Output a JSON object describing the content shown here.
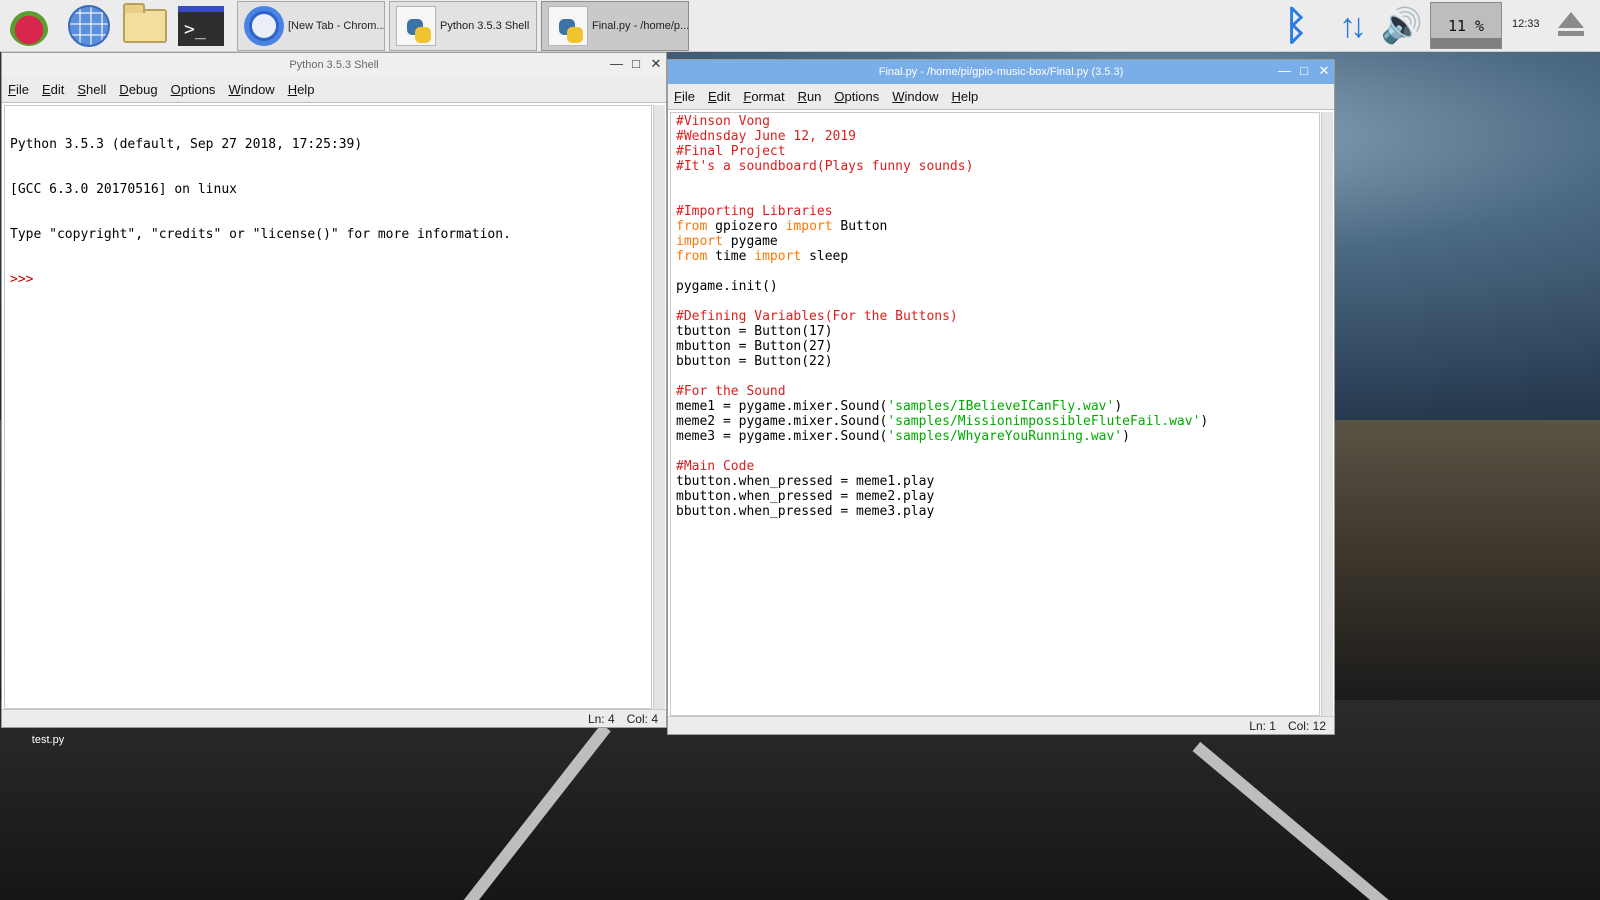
{
  "taskbar": {
    "launchers": [
      "raspberry-menu-icon",
      "web-browser-icon",
      "file-manager-icon",
      "terminal-icon"
    ],
    "terminal_glyph": ">_",
    "tasks": [
      {
        "label": "[New Tab - Chrom...",
        "icon": "chromium-icon"
      },
      {
        "label": "Python 3.5.3 Shell",
        "icon": "python-icon"
      },
      {
        "label": "Final.py - /home/p...",
        "icon": "python-icon"
      }
    ],
    "cpu_label": "11 %",
    "clock": "12:33"
  },
  "shell": {
    "title": "Python 3.5.3 Shell",
    "menus": [
      "File",
      "Edit",
      "Shell",
      "Debug",
      "Options",
      "Window",
      "Help"
    ],
    "lines": [
      "Python 3.5.3 (default, Sep 27 2018, 17:25:39)",
      "[GCC 6.3.0 20170516] on linux",
      "Type \"copyright\", \"credits\" or \"license()\" for more information."
    ],
    "prompt": ">>>",
    "status": {
      "ln": "Ln: 4",
      "col": "Col: 4"
    }
  },
  "editor": {
    "title": "Final.py - /home/pi/gpio-music-box/Final.py (3.5.3)",
    "menus": [
      "File",
      "Edit",
      "Format",
      "Run",
      "Options",
      "Window",
      "Help"
    ],
    "code": [
      [
        {
          "t": "#Vinson Vong",
          "c": "comment"
        }
      ],
      [
        {
          "t": "#Wednsday June 12, 2019",
          "c": "comment"
        }
      ],
      [
        {
          "t": "#Final Project",
          "c": "comment"
        }
      ],
      [
        {
          "t": "#It's a soundboard(Plays funny sounds)",
          "c": "comment"
        }
      ],
      [],
      [],
      [
        {
          "t": "#Importing Libraries",
          "c": "comment"
        }
      ],
      [
        {
          "t": "from",
          "c": "kw"
        },
        {
          "t": " gpiozero ",
          "c": ""
        },
        {
          "t": "import",
          "c": "kw"
        },
        {
          "t": " Button",
          "c": ""
        }
      ],
      [
        {
          "t": "import",
          "c": "kw"
        },
        {
          "t": " pygame",
          "c": ""
        }
      ],
      [
        {
          "t": "from",
          "c": "kw"
        },
        {
          "t": " time ",
          "c": ""
        },
        {
          "t": "import",
          "c": "kw"
        },
        {
          "t": " sleep",
          "c": ""
        }
      ],
      [],
      [
        {
          "t": "pygame.init()",
          "c": ""
        }
      ],
      [],
      [
        {
          "t": "#Defining Variables(For the Buttons)",
          "c": "comment"
        }
      ],
      [
        {
          "t": "tbutton = Button(17)",
          "c": ""
        }
      ],
      [
        {
          "t": "mbutton = Button(27)",
          "c": ""
        }
      ],
      [
        {
          "t": "bbutton = Button(22)",
          "c": ""
        }
      ],
      [],
      [
        {
          "t": "#For the Sound",
          "c": "comment"
        }
      ],
      [
        {
          "t": "meme1 = pygame.mixer.Sound(",
          "c": ""
        },
        {
          "t": "'samples/IBelieveICanFly.wav'",
          "c": "str"
        },
        {
          "t": ")",
          "c": ""
        }
      ],
      [
        {
          "t": "meme2 = pygame.mixer.Sound(",
          "c": ""
        },
        {
          "t": "'samples/MissionimpossibleFluteFail.wav'",
          "c": "str"
        },
        {
          "t": ")",
          "c": ""
        }
      ],
      [
        {
          "t": "meme3 = pygame.mixer.Sound(",
          "c": ""
        },
        {
          "t": "'samples/WhyareYouRunning.wav'",
          "c": "str"
        },
        {
          "t": ")",
          "c": ""
        }
      ],
      [],
      [
        {
          "t": "#Main Code",
          "c": "comment"
        }
      ],
      [
        {
          "t": "tbutton.when_pressed = meme1.play",
          "c": ""
        }
      ],
      [
        {
          "t": "mbutton.when_pressed = meme2.play",
          "c": ""
        }
      ],
      [
        {
          "t": "bbutton.when_pressed = meme3.play",
          "c": ""
        }
      ]
    ],
    "status": {
      "ln": "Ln: 1",
      "col": "Col: 12"
    }
  },
  "desktop": {
    "file_icon_label": "test.py"
  },
  "colors": {
    "comment": "#dd1e1e",
    "keyword": "#ff7700",
    "string": "#00aa00",
    "active_title": "#7aaee8",
    "tray_blue": "#2a7ce0"
  }
}
